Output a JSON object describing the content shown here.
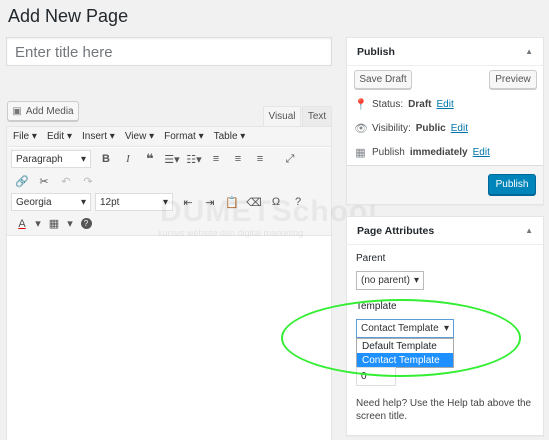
{
  "page_title": "Add New Page",
  "title_placeholder": "Enter title here",
  "add_media": "Add Media",
  "tabs": {
    "visual": "Visual",
    "text": "Text"
  },
  "menubar": [
    "File",
    "Edit",
    "Insert",
    "View",
    "Format",
    "Table"
  ],
  "toolbar": {
    "format_select": "Paragraph",
    "font_select": "Georgia",
    "size_select": "12pt",
    "bold": "B",
    "italic": "I",
    "quote": "❝",
    "omega": "Ω",
    "text_color": "A"
  },
  "watermark": {
    "title": "DUMETSchool",
    "subtitle": "kursus website dan digital marketing"
  },
  "publish": {
    "title": "Publish",
    "save_draft": "Save Draft",
    "preview": "Preview",
    "status_label": "Status:",
    "status_value": "Draft",
    "visibility_label": "Visibility:",
    "visibility_value": "Public",
    "schedule_label": "Publish",
    "schedule_value": "immediately",
    "edit": "Edit",
    "publish_button": "Publish"
  },
  "attributes": {
    "title": "Page Attributes",
    "parent_label": "Parent",
    "parent_value": "(no parent)",
    "template_label": "Template",
    "template_value": "Contact Template",
    "template_options": [
      "Default Template",
      "Contact Template"
    ],
    "order_value": "0",
    "help_text": "Need help? Use the Help tab above the screen title."
  },
  "colors": {
    "primary": "#0085ba",
    "link": "#0073aa",
    "highlight": "#33ee33",
    "selected_option": "#1e90ff"
  }
}
